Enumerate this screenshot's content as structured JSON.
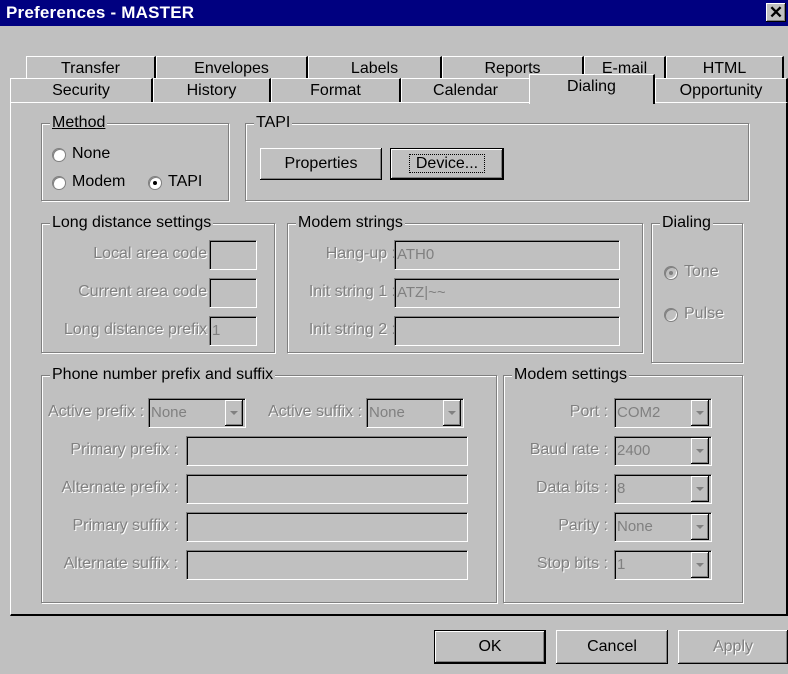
{
  "window": {
    "title": "Preferences  -  MASTER",
    "close_label": "✕"
  },
  "tabs_back": [
    "Transfer",
    "Envelopes",
    "Labels",
    "Reports",
    "E-mail",
    "HTML"
  ],
  "tabs_front": [
    "Security",
    "History",
    "Format",
    "Calendar",
    "Dialing",
    "Opportunity"
  ],
  "selected_tab": "Dialing",
  "method": {
    "title": "Method",
    "options": [
      "None",
      "Modem",
      "TAPI"
    ],
    "selected": "TAPI"
  },
  "tapi": {
    "title": "TAPI",
    "properties_label": "Properties",
    "device_label": "Device..."
  },
  "long_distance": {
    "title": "Long distance settings",
    "local_area_code_label": "Local area code :",
    "local_area_code_value": "",
    "current_area_code_label": "Current area code :",
    "current_area_code_value": "",
    "prefix_label": "Long distance prefix :",
    "prefix_value": "1"
  },
  "modem_strings": {
    "title": "Modem strings",
    "hangup_label": "Hang-up :",
    "hangup_value": "ATH0",
    "init1_label": "Init string 1 :",
    "init1_value": "ATZ|~~",
    "init2_label": "Init string 2 :",
    "init2_value": ""
  },
  "dialing": {
    "title": "Dialing",
    "options": [
      "Tone",
      "Pulse"
    ],
    "selected": "Tone"
  },
  "phone_prefix": {
    "title": "Phone number prefix and suffix",
    "active_prefix_label": "Active prefix :",
    "active_prefix_value": "None",
    "active_suffix_label": "Active suffix :",
    "active_suffix_value": "None",
    "primary_prefix_label": "Primary prefix :",
    "alternate_prefix_label": "Alternate prefix :",
    "primary_suffix_label": "Primary suffix :",
    "alternate_suffix_label": "Alternate suffix :"
  },
  "modem_settings": {
    "title": "Modem settings",
    "port_label": "Port :",
    "port_value": "COM2",
    "baud_label": "Baud rate :",
    "baud_value": "2400",
    "data_bits_label": "Data bits :",
    "data_bits_value": "8",
    "parity_label": "Parity :",
    "parity_value": "None",
    "stop_bits_label": "Stop bits :",
    "stop_bits_value": "1"
  },
  "buttons": {
    "ok": "OK",
    "cancel": "Cancel",
    "apply": "Apply"
  }
}
